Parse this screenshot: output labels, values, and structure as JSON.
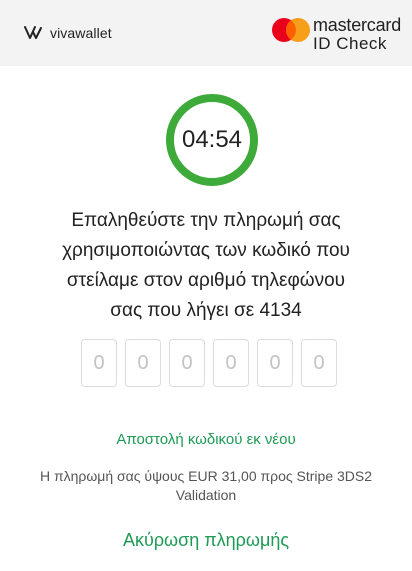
{
  "header": {
    "brand_text": "vivawallet",
    "mastercard_wordmark": "mastercard",
    "mastercard_subtitle": "ID Check",
    "mastercard_colors": {
      "red": "#eb001b",
      "yellow": "#f79e1b",
      "overlap": "#ff5f00"
    }
  },
  "timer": {
    "value": "04:54",
    "ring_color": "#3eaa3a",
    "progress": 1.0
  },
  "instructions": {
    "line1": "Επαληθεύστε την πληρωμή σας",
    "line2": "χρησιμοποιώντας των κωδικό που",
    "line3": "στείλαμε στον αριθμό τηλεφώνου",
    "line4": "σας που λήγει σε 4134"
  },
  "otp": {
    "digits": [
      "0",
      "0",
      "0",
      "0",
      "0",
      "0"
    ]
  },
  "resend_label": "Αποστολή κωδικού εκ νέου",
  "payment_info": {
    "line1": "Η πληρωμή σας ύψους EUR 31,00 προς Stripe 3DS2",
    "line2": "Validation"
  },
  "cancel_label": "Ακύρωση πληρωμής",
  "accent_color": "#1e9a55"
}
